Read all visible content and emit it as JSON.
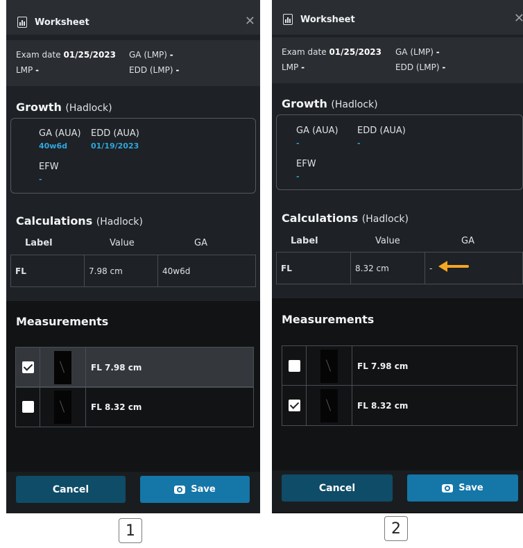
{
  "panels": [
    {
      "header": {
        "title": "Worksheet"
      },
      "exam": {
        "exam_date_label": "Exam date",
        "exam_date": "01/25/2023",
        "ga_lmp_label": "GA (LMP)",
        "ga_lmp": "-",
        "lmp_label": "LMP",
        "lmp": "-",
        "edd_lmp_label": "EDD (LMP)",
        "edd_lmp": "-"
      },
      "growth": {
        "title": "Growth",
        "method": "(Hadlock)",
        "ga_aua_label": "GA (AUA)",
        "ga_aua": "40w6d",
        "edd_aua_label": "EDD (AUA)",
        "edd_aua": "01/19/2023",
        "efw_label": "EFW",
        "efw": "-"
      },
      "calculations": {
        "title": "Calculations",
        "method": "(Hadlock)",
        "columns": [
          "Label",
          "Value",
          "GA"
        ],
        "row": {
          "label": "FL",
          "value": "7.98 cm",
          "ga": "40w6d"
        }
      },
      "measurements": {
        "title": "Measurements",
        "items": [
          {
            "text": "FL 7.98 cm",
            "checked": true
          },
          {
            "text": "FL 8.32 cm",
            "checked": false
          }
        ]
      },
      "footer": {
        "cancel": "Cancel",
        "save": "Save"
      },
      "badge": "1"
    },
    {
      "header": {
        "title": "Worksheet"
      },
      "exam": {
        "exam_date_label": "Exam date",
        "exam_date": "01/25/2023",
        "ga_lmp_label": "GA (LMP)",
        "ga_lmp": "-",
        "lmp_label": "LMP",
        "lmp": "-",
        "edd_lmp_label": "EDD (LMP)",
        "edd_lmp": "-"
      },
      "growth": {
        "title": "Growth",
        "method": "(Hadlock)",
        "ga_aua_label": "GA (AUA)",
        "ga_aua": "-",
        "edd_aua_label": "EDD (AUA)",
        "edd_aua": "-",
        "efw_label": "EFW",
        "efw": "-"
      },
      "calculations": {
        "title": "Calculations",
        "method": "(Hadlock)",
        "columns": [
          "Label",
          "Value",
          "GA"
        ],
        "row": {
          "label": "FL",
          "value": "8.32 cm",
          "ga": "-"
        }
      },
      "measurements": {
        "title": "Measurements",
        "items": [
          {
            "text": "FL 7.98 cm",
            "checked": false
          },
          {
            "text": "FL 8.32 cm",
            "checked": true
          }
        ]
      },
      "footer": {
        "cancel": "Cancel",
        "save": "Save"
      },
      "badge": "2"
    }
  ],
  "colors": {
    "accent": "#2ea7e0",
    "arrow": "#f5a623",
    "save_button": "#1576a8",
    "cancel_button": "#0f4c68"
  }
}
